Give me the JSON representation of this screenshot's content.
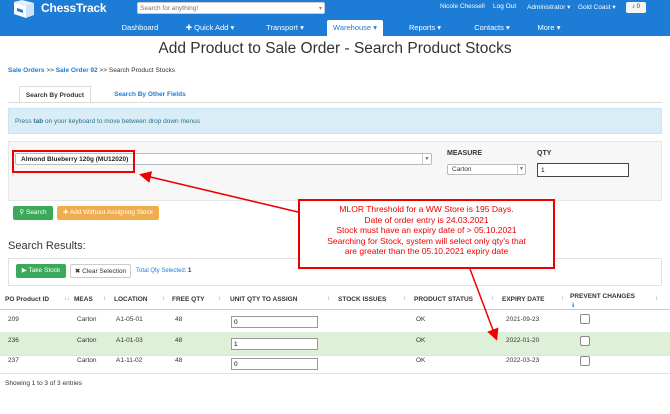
{
  "header": {
    "brand": "ChessTrack",
    "search_placeholder": "Search for anything!",
    "user": "Nicole Chessell",
    "logout": "Log Out",
    "role": "Administrator",
    "role_caret": "▾",
    "location": "Gold Coast",
    "location_caret": "▾",
    "notifications": "0",
    "nav": [
      "Dashboard",
      "Quick Add",
      "Transport",
      "Warehouse",
      "Reports",
      "Contacts",
      "More"
    ],
    "active_nav": "Warehouse",
    "accent_color": "#1c7cd6"
  },
  "page": {
    "title": "Add Product to Sale Order - Search Product Stocks",
    "breadcrumbs": [
      "Sale Orders",
      "Sale Order 92",
      "Search Product Stocks"
    ],
    "breadcrumb_sep": ">>"
  },
  "tabs": {
    "by_product": "Search By Product",
    "by_other": "Search By Other Fields"
  },
  "info": {
    "prefix": "Press ",
    "key": "tab",
    "suffix": " on your keyboard to move between drop down menus"
  },
  "form": {
    "product_value": "Almond Blueberry 120g (MU12020)",
    "measure_label": "MEASURE",
    "measure_value": "Carton",
    "qty_label": "QTY",
    "qty_value": "1",
    "search_button": "Search",
    "add_without_button": "Add Without Assigning Stock"
  },
  "annotation": {
    "lines": [
      "MLOR Threshold for a WW Store is 195 Days.",
      "Date of order entry is 24.03.2021",
      "Stock must have an expiry date of > 05.10.2021",
      "Searching for Stock, system will select only qty's that",
      "are greater than the 05.10.2021 expiry date"
    ],
    "color": "#ee0000"
  },
  "results": {
    "title": "Search Results:",
    "take_stock": "Take Stock",
    "clear_selection": "Clear Selection",
    "total_label": "Total Qty Selected:",
    "total_value": "1",
    "columns": [
      "PO Product ID",
      "MEAS",
      "LOCATION",
      "FREE QTY",
      "UNIT QTY TO ASSIGN",
      "STOCK ISSUES",
      "PRODUCT STATUS",
      "EXPIRY DATE",
      "PREVENT CHANGES"
    ],
    "rows": [
      {
        "id": "209",
        "meas": "Carton",
        "location": "A1-05-01",
        "free_qty": "48",
        "assign": "0",
        "issues": "",
        "status": "OK",
        "expiry": "2021-09-23"
      },
      {
        "id": "236",
        "meas": "Carton",
        "location": "A1-01-03",
        "free_qty": "48",
        "assign": "1",
        "issues": "",
        "status": "OK",
        "expiry": "2022-01-20"
      },
      {
        "id": "237",
        "meas": "Carton",
        "location": "A1-11-02",
        "free_qty": "48",
        "assign": "0",
        "issues": "",
        "status": "OK",
        "expiry": "2022-03-23"
      }
    ],
    "highlight_row": 1,
    "highlight_color": "#dff0d8",
    "footer": "Showing 1 to 3 of 3 entries"
  }
}
